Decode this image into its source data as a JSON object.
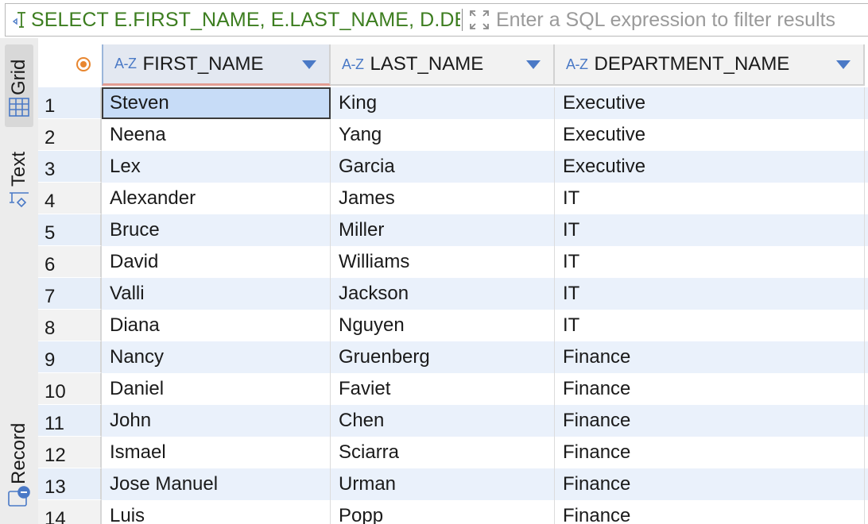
{
  "filter_bar": {
    "sql_text": "SELECT E.FIRST_NAME, E.LAST_NAME, D.DEPARTMENT_NAME",
    "filter_placeholder": "Enter a SQL expression to filter results",
    "sql_icon": "sql-text-icon",
    "expand_icon": "expand-arrows-icon"
  },
  "side_panel": {
    "grid_label": "Grid",
    "text_label": "Text",
    "record_label": "Record",
    "grid_icon": "grid-table-icon",
    "text_icon": "text-view-icon",
    "record_icon": "record-view-icon"
  },
  "grid": {
    "columns": [
      {
        "type_badge": "A-Z",
        "title": "FIRST_NAME"
      },
      {
        "type_badge": "A-Z",
        "title": "LAST_NAME"
      },
      {
        "type_badge": "A-Z",
        "title": "DEPARTMENT_NAME"
      }
    ],
    "rows": [
      {
        "num": "1",
        "first": "Steven",
        "last": "King",
        "dept": "Executive"
      },
      {
        "num": "2",
        "first": "Neena",
        "last": "Yang",
        "dept": "Executive"
      },
      {
        "num": "3",
        "first": "Lex",
        "last": "Garcia",
        "dept": "Executive"
      },
      {
        "num": "4",
        "first": "Alexander",
        "last": "James",
        "dept": "IT"
      },
      {
        "num": "5",
        "first": "Bruce",
        "last": "Miller",
        "dept": "IT"
      },
      {
        "num": "6",
        "first": "David",
        "last": "Williams",
        "dept": "IT"
      },
      {
        "num": "7",
        "first": "Valli",
        "last": "Jackson",
        "dept": "IT"
      },
      {
        "num": "8",
        "first": "Diana",
        "last": "Nguyen",
        "dept": "IT"
      },
      {
        "num": "9",
        "first": "Nancy",
        "last": "Gruenberg",
        "dept": "Finance"
      },
      {
        "num": "10",
        "first": "Daniel",
        "last": "Faviet",
        "dept": "Finance"
      },
      {
        "num": "11",
        "first": "John",
        "last": "Chen",
        "dept": "Finance"
      },
      {
        "num": "12",
        "first": "Ismael",
        "last": "Sciarra",
        "dept": "Finance"
      },
      {
        "num": "13",
        "first": "Jose Manuel",
        "last": "Urman",
        "dept": "Finance"
      },
      {
        "num": "14",
        "first": "Luis",
        "last": "Popp",
        "dept": "Finance"
      }
    ]
  },
  "colors": {
    "sql_text": "#3c7d1f",
    "accent_blue": "#4a79c6",
    "row_alt": "#eaf1fb",
    "selected_cell": "#c7dcf7",
    "indicator_orange": "#e8862f"
  }
}
